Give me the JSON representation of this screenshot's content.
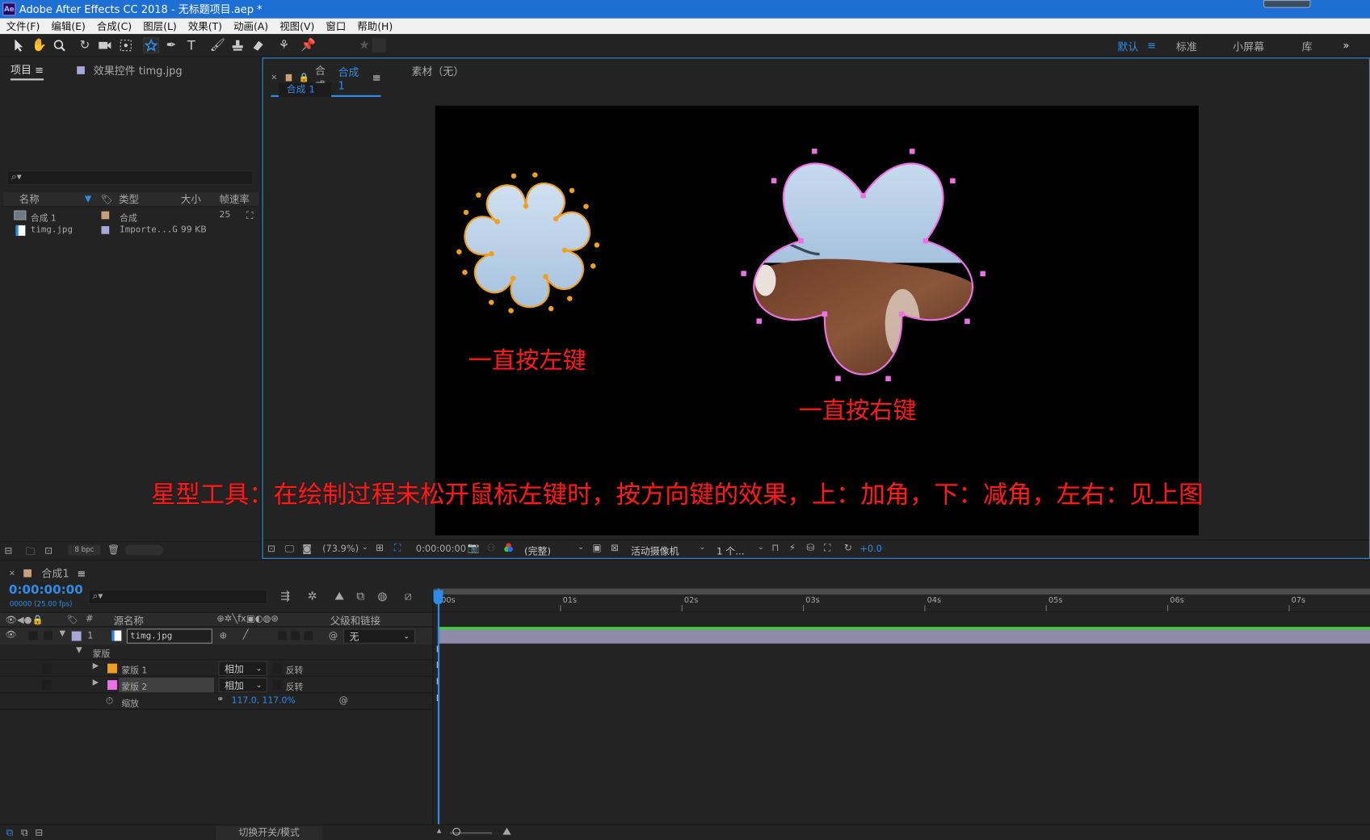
{
  "window": {
    "title": "Adobe After Effects CC 2018 - 无标题项目.aep *",
    "icon": "Ae"
  },
  "menu": [
    "文件(F)",
    "编辑(E)",
    "合成(C)",
    "图层(L)",
    "效果(T)",
    "动画(A)",
    "视图(V)",
    "窗口",
    "帮助(H)"
  ],
  "workspaces": {
    "default": "默认",
    "standard": "标准",
    "small": "小屏幕",
    "library": "库"
  },
  "project": {
    "tab": "项目",
    "effects_tab": "效果控件 timg.jpg",
    "bpc": "8 bpc",
    "columns": {
      "name": "名称",
      "type": "类型",
      "size": "大小",
      "fps": "帧速率"
    },
    "items": [
      {
        "name": "合成 1",
        "type": "合成",
        "size": "",
        "fps": "25",
        "color": "#c8a07a"
      },
      {
        "name": "timg.jpg",
        "type": "Importe...G",
        "size": "99 KB",
        "fps": "",
        "color": "#a7a7d9"
      }
    ]
  },
  "composition": {
    "tab_prefix": "合成",
    "tab_name": "合成 1",
    "footage_tab": "素材（无）",
    "breadcrumb": "合成 1",
    "zoom": "(73.9%)",
    "timecode": "0:00:00:00",
    "resolution": "(完整)",
    "camera": "活动摄像机",
    "views": "1 个...",
    "exposure": "+0.0",
    "label_left": "一直按左键",
    "label_right": "一直按右键",
    "caption": "星型工具：在绘制过程未松开鼠标左键时，按方向键的效果，上：加角，下：减角，左右：见上图",
    "colors": {
      "mask1": "#f0a020",
      "mask2": "#ef6fe6",
      "caption": "#ff1a1a"
    }
  },
  "timeline": {
    "tab": "合成1",
    "timecode": "0:00:00:00",
    "fps_note": "00000 (25.00 fps)",
    "ruler": [
      "00s",
      "01s",
      "02s",
      "03s",
      "04s",
      "05s",
      "06s",
      "07s"
    ],
    "col_source": "源名称",
    "col_parent": "父级和链接",
    "layer": {
      "num": "1",
      "name": "timg.jpg",
      "parent": "无"
    },
    "masks_group": "蒙版",
    "masks": [
      {
        "name": "蒙版 1",
        "mode": "相加",
        "invert": "反转",
        "color": "#f0a020"
      },
      {
        "name": "蒙版 2",
        "mode": "相加",
        "invert": "反转",
        "color": "#ef6fe6"
      }
    ],
    "scale": {
      "label": "缩放",
      "value": "117.0, 117.0%"
    },
    "footer": "切换开关/模式"
  }
}
